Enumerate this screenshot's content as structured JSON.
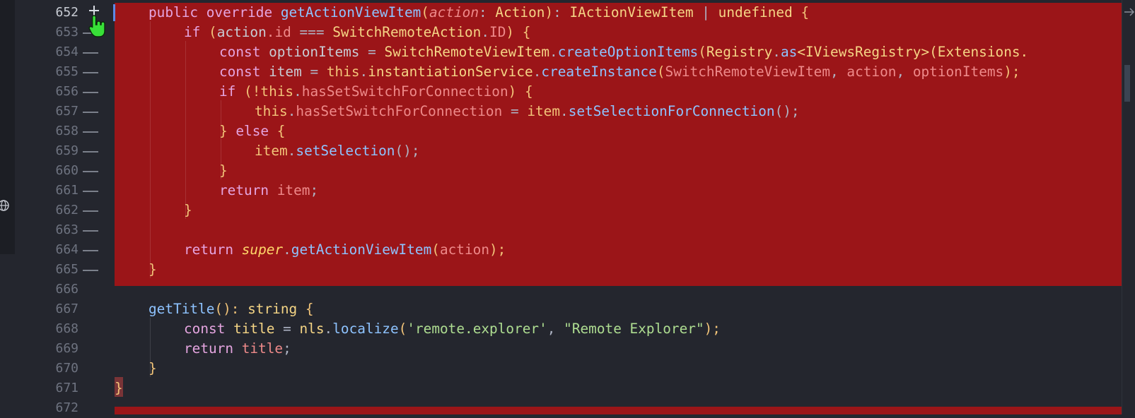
{
  "editor": {
    "gutter": {
      "line_numbers": [
        "652",
        "653",
        "654",
        "655",
        "656",
        "657",
        "658",
        "659",
        "660",
        "661",
        "662",
        "663",
        "664",
        "665",
        "666",
        "667",
        "668",
        "669",
        "670",
        "671",
        "672"
      ]
    },
    "code": {
      "l652": [
        "public",
        "override",
        "getActionViewItem",
        "action",
        "Action",
        "IActionViewItem",
        "|",
        "undefined",
        "{"
      ],
      "l653": [
        "if",
        "(",
        "action",
        ".id",
        "===",
        "SwitchRemoteAction",
        ".",
        "ID",
        ")",
        "{"
      ],
      "l654": [
        "const",
        "optionItems",
        "=",
        "SwitchRemoteViewItem",
        ".",
        "createOptionItems",
        "(",
        "Registry",
        ".",
        "as",
        "<IViewsRegistry>",
        "(Extensions."
      ],
      "l655": [
        "const",
        "item",
        "=",
        "this",
        ".",
        "instantiationService",
        ".",
        "createInstance",
        "(",
        "SwitchRemoteViewItem",
        ",",
        "action",
        ",",
        "optionItems",
        ");"
      ],
      "l656": [
        "if",
        "(!",
        "this",
        ".",
        "hasSetSwitchForConnection",
        ")",
        "{"
      ],
      "l657": [
        "this",
        ".",
        "hasSetSwitchForConnection",
        "=",
        "item",
        ".",
        "setSelectionForConnection",
        "();"
      ],
      "l658": [
        "}",
        "else",
        "{"
      ],
      "l659": [
        "item",
        ".",
        "setSelection",
        "();"
      ],
      "l660": [
        "}"
      ],
      "l661": [
        "return",
        "item",
        ";"
      ],
      "l662": [
        "}"
      ],
      "l664": [
        "return",
        "super",
        ".",
        "getActionViewItem",
        "(",
        "action",
        ");"
      ],
      "l665": [
        "}"
      ],
      "l667": [
        "getTitle",
        "():",
        "string",
        "{"
      ],
      "l668": [
        "const",
        "title",
        "=",
        "nls",
        ".",
        "localize",
        "(",
        "'remote.explorer'",
        ",",
        "\"Remote Explorer\"",
        ");"
      ],
      "l669": [
        "return",
        "title",
        ";"
      ],
      "l670": [
        "}"
      ],
      "l671": [
        "}"
      ]
    },
    "colors": {
      "background": "#24262e",
      "deleted_block": "#9b1518",
      "cursor_hand": "#38e038",
      "change_bar": "#5c8ae6"
    },
    "icons": [
      "plus-icon",
      "hand-cursor-icon",
      "globe-icon",
      "arrow-right-icon"
    ]
  }
}
